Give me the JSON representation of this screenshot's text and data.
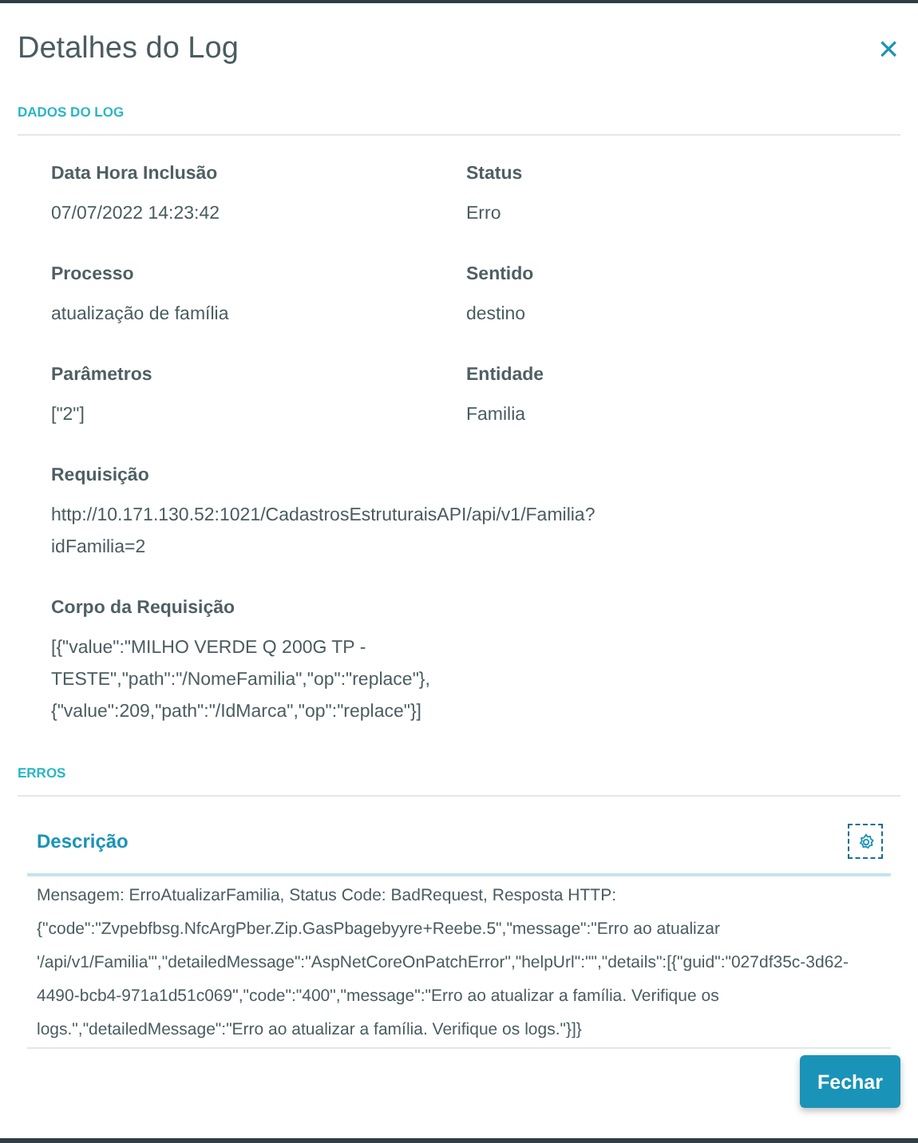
{
  "dialog": {
    "title": "Detalhes do Log",
    "close_icon": "×"
  },
  "sections": [
    {
      "title": "DADOS DO LOG"
    },
    {
      "title": "ERROS"
    }
  ],
  "fields": [
    {
      "label": "Data Hora Inclusão",
      "value": "07/07/2022 14:23:42",
      "wide": false
    },
    {
      "label": "Status",
      "value": "Erro",
      "wide": false
    },
    {
      "label": "Processo",
      "value": "atualização de família",
      "wide": false
    },
    {
      "label": "Sentido",
      "value": "destino",
      "wide": false
    },
    {
      "label": "Parâmetros",
      "value": "[\"2\"]",
      "wide": false
    },
    {
      "label": "Entidade",
      "value": "Familia",
      "wide": false
    },
    {
      "label": "Requisição",
      "value": "http://10.171.130.52:1021/CadastrosEstruturaisAPI/api/v1/Familia?idFamilia=2",
      "wide": true
    },
    {
      "label": "Corpo da Requisição",
      "value": "[{\"value\":\"MILHO VERDE Q 200G TP - TESTE\",\"path\":\"/NomeFamilia\",\"op\":\"replace\"},{\"value\":209,\"path\":\"/IdMarca\",\"op\":\"replace\"}]",
      "wide": true
    }
  ],
  "errors_table": {
    "columns": [
      "Descrição"
    ],
    "rows": [
      [
        "Mensagem: ErroAtualizarFamilia, Status Code: BadRequest, Resposta HTTP: {\"code\":\"Zvpebfbsg.NfcArgPber.Zip.GasPbagebyyre+Reebe.5\",\"message\":\"Erro ao atualizar '/api/v1/Familia'\",\"detailedMessage\":\"AspNetCoreOnPatchError\",\"helpUrl\":\"\",\"details\":[{\"guid\":\"027df35c-3d62-4490-bcb4-971a1d51c069\",\"code\":\"400\",\"message\":\"Erro ao atualizar a família. Verifique os logs.\",\"detailedMessage\":\"Erro ao atualizar a família. Verifique os logs.\"}]}"
      ]
    ]
  },
  "buttons": [
    "Fechar"
  ]
}
